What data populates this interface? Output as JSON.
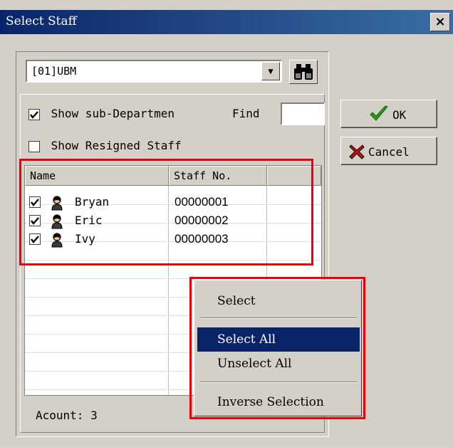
{
  "window": {
    "title": "Select Staff",
    "close_label": "×"
  },
  "department": {
    "value": "[01]UBM",
    "dropdown_glyph": "▼"
  },
  "options": {
    "show_sub_departments": {
      "label": "Show sub-Departmen",
      "checked": true
    },
    "show_resigned_staff": {
      "label": "Show Resigned Staff",
      "checked": false
    },
    "find_label": "Find",
    "find_value": ""
  },
  "list": {
    "columns": [
      "Name",
      "Staff No."
    ],
    "rows": [
      {
        "name": "Bryan",
        "staff_no": "00000001",
        "checked": true
      },
      {
        "name": "Eric",
        "staff_no": "00000002",
        "checked": true
      },
      {
        "name": "Ivy",
        "staff_no": "00000003",
        "checked": true
      }
    ]
  },
  "status": {
    "count_text": "Acount: 3"
  },
  "buttons": {
    "ok_label": "OK",
    "cancel_label": "Cancel"
  },
  "context_menu": {
    "items": [
      "Select",
      "Select All",
      "Unselect All",
      "Inverse Selection"
    ],
    "highlighted": "Select All"
  },
  "colors": {
    "accent_selection": "#0a246a",
    "highlight_box": "#e8000a",
    "ok_check": "#2e9a1c",
    "cancel_x": "#c0140c"
  },
  "icons": [
    "close-icon",
    "dropdown-arrow-icon",
    "binoculars-icon",
    "checkmark-icon",
    "cancel-x-icon",
    "person-icon"
  ]
}
